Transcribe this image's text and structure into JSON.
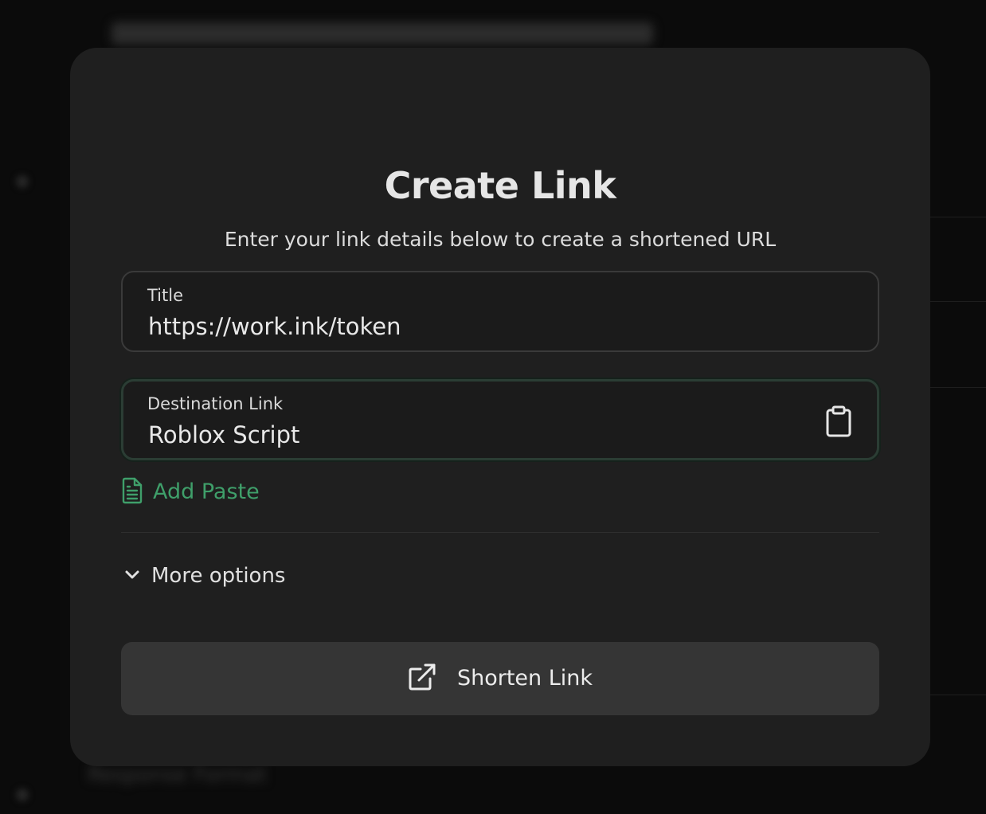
{
  "modal": {
    "title": "Create Link",
    "subtitle": "Enter your link details below to create a shortened URL"
  },
  "fields": {
    "title": {
      "label": "Title",
      "value": "https://work.ink/token"
    },
    "destination": {
      "label": "Destination Link",
      "value": "Roblox Script",
      "action_icon": "clipboard-icon"
    }
  },
  "add_paste": {
    "label": "Add Paste",
    "icon": "document-icon"
  },
  "more_options": {
    "label": "More options",
    "icon": "chevron-down-icon"
  },
  "submit": {
    "label": "Shorten Link",
    "icon": "external-link-icon"
  },
  "background": {
    "heading": "Response Format"
  },
  "colors": {
    "accent": "#3f9f6a",
    "modal_bg": "#1f1f1f",
    "button_bg": "#353535",
    "focus_border": "#2b3d34"
  }
}
